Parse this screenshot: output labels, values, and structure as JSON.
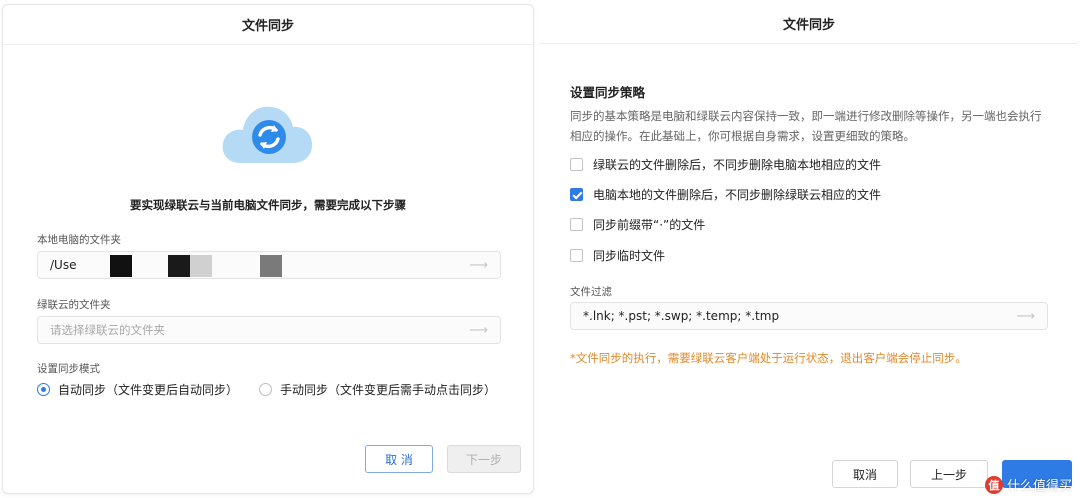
{
  "left": {
    "title": "文件同步",
    "heading": "要实现绿联云与当前电脑文件同步，需要完成以下步骤",
    "local_folder": {
      "label": "本地电脑的文件夹",
      "value": "/Use"
    },
    "cloud_folder": {
      "label": "绿联云的文件夹",
      "placeholder": "请选择绿联云的文件夹"
    },
    "sync_mode": {
      "label": "设置同步模式",
      "options": [
        {
          "label": "自动同步（文件变更后自动同步）",
          "checked": true
        },
        {
          "label": "手动同步（文件变更后需手动点击同步）",
          "checked": false
        }
      ]
    },
    "buttons": {
      "cancel": "取 消",
      "next": "下一步"
    }
  },
  "right": {
    "title": "文件同步",
    "section_title": "设置同步策略",
    "description": "同步的基本策略是电脑和绿联云内容保持一致，即一端进行修改删除等操作，另一端也会执行相应的操作。在此基础上，你可根据自身需求，设置更细致的策略。",
    "options": [
      {
        "label": "绿联云的文件删除后，不同步删除电脑本地相应的文件",
        "checked": false
      },
      {
        "label": "电脑本地的文件删除后，不同步删除绿联云相应的文件",
        "checked": true
      },
      {
        "label": "同步前缀带“·”的文件",
        "checked": false
      },
      {
        "label": "同步临时文件",
        "checked": false
      }
    ],
    "filter": {
      "label": "文件过滤",
      "value": "*.lnk; *.pst; *.swp; *.temp; *.tmp"
    },
    "warning": "*文件同步的执行，需要绿联云客户端处于运行状态，退出客户端会停止同步。",
    "buttons": {
      "cancel": "取消",
      "prev": "上一步"
    }
  },
  "watermark": {
    "badge": "值",
    "text": "什么值得买"
  },
  "colors": {
    "accent": "#2e7be6",
    "warning": "#e08a2c",
    "cloud": "#a9d3f3"
  },
  "icons": [
    "sync-cloud-icon",
    "arrow-right-icon",
    "radio-icon",
    "checkbox-icon"
  ]
}
